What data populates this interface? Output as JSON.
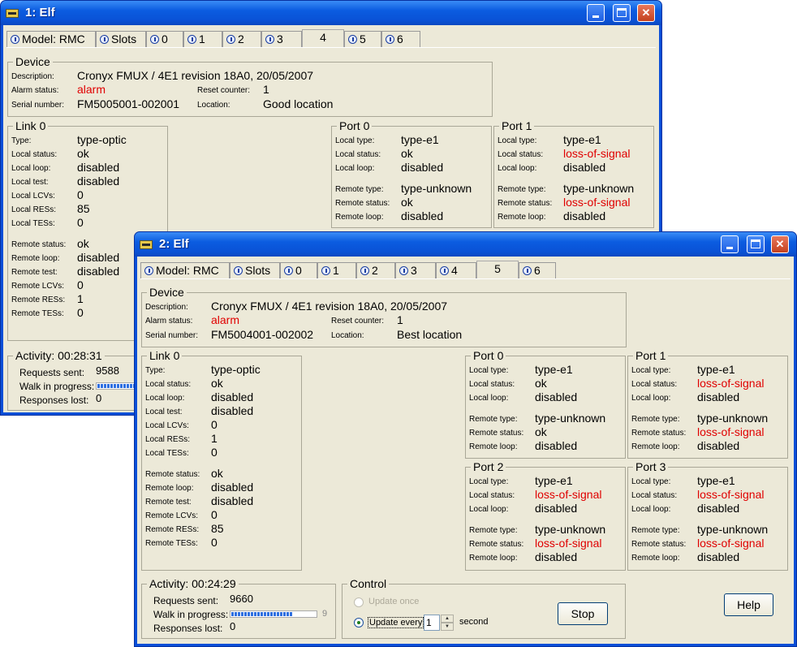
{
  "w1": {
    "title": "1: Elf",
    "tabs": [
      "Model: RMC",
      "Slots",
      "0",
      "1",
      "2",
      "3",
      "4",
      "5",
      "6"
    ],
    "device": {
      "heading": "Device",
      "description_label": "Description:",
      "description": "Cronyx FMUX / 4E1 revision 18A0, 20/05/2007",
      "alarm_label": "Alarm status:",
      "alarm": "alarm",
      "serial_label": "Serial number:",
      "serial": "FM5005001-002001",
      "reset_label": "Reset counter:",
      "reset": "1",
      "location_label": "Location:",
      "location": "Good location"
    },
    "link": {
      "heading": "Link 0",
      "rows": [
        {
          "l": "Type:",
          "v": "type-optic"
        },
        {
          "l": "Local status:",
          "v": "ok"
        },
        {
          "l": "Local loop:",
          "v": "disabled"
        },
        {
          "l": "Local test:",
          "v": "disabled"
        },
        {
          "l": "Local LCVs:",
          "v": "0"
        },
        {
          "l": "Local RESs:",
          "v": "85"
        },
        {
          "l": "Local TESs:",
          "v": "0"
        },
        {
          "l": "Remote status:",
          "v": "ok"
        },
        {
          "l": "Remote loop:",
          "v": "disabled"
        },
        {
          "l": "Remote test:",
          "v": "disabled"
        },
        {
          "l": "Remote LCVs:",
          "v": "0"
        },
        {
          "l": "Remote RESs:",
          "v": "1"
        },
        {
          "l": "Remote TESs:",
          "v": "0"
        }
      ]
    },
    "ports": [
      {
        "heading": "Port 0",
        "rows": [
          {
            "l": "Local type:",
            "v": "type-e1"
          },
          {
            "l": "Local status:",
            "v": "ok"
          },
          {
            "l": "Local loop:",
            "v": "disabled"
          },
          {
            "l": "Remote type:",
            "v": "type-unknown"
          },
          {
            "l": "Remote status:",
            "v": "ok"
          },
          {
            "l": "Remote loop:",
            "v": "disabled"
          }
        ]
      },
      {
        "heading": "Port 1",
        "rows": [
          {
            "l": "Local type:",
            "v": "type-e1"
          },
          {
            "l": "Local status:",
            "v": "loss-of-signal"
          },
          {
            "l": "Local loop:",
            "v": "disabled"
          },
          {
            "l": "Remote type:",
            "v": "type-unknown"
          },
          {
            "l": "Remote status:",
            "v": "loss-of-signal"
          },
          {
            "l": "Remote loop:",
            "v": "disabled"
          }
        ]
      }
    ],
    "activity": {
      "heading": "Activity: 00:28:31",
      "requests_label": "Requests sent:",
      "requests": "9588",
      "walk_label": "Walk in progress:",
      "lost_label": "Responses lost:",
      "lost": "0"
    }
  },
  "w2": {
    "title": "2: Elf",
    "tabs": [
      "Model: RMC",
      "Slots",
      "0",
      "1",
      "2",
      "3",
      "4",
      "5",
      "6"
    ],
    "device": {
      "heading": "Device",
      "description_label": "Description:",
      "description": "Cronyx FMUX / 4E1 revision 18A0, 20/05/2007",
      "alarm_label": "Alarm status:",
      "alarm": "alarm",
      "serial_label": "Serial number:",
      "serial": "FM5004001-002002",
      "reset_label": "Reset counter:",
      "reset": "1",
      "location_label": "Location:",
      "location": "Best location"
    },
    "link": {
      "heading": "Link 0",
      "rows": [
        {
          "l": "Type:",
          "v": "type-optic"
        },
        {
          "l": "Local status:",
          "v": "ok"
        },
        {
          "l": "Local loop:",
          "v": "disabled"
        },
        {
          "l": "Local test:",
          "v": "disabled"
        },
        {
          "l": "Local LCVs:",
          "v": "0"
        },
        {
          "l": "Local RESs:",
          "v": "1"
        },
        {
          "l": "Local TESs:",
          "v": "0"
        },
        {
          "l": "Remote status:",
          "v": "ok"
        },
        {
          "l": "Remote loop:",
          "v": "disabled"
        },
        {
          "l": "Remote test:",
          "v": "disabled"
        },
        {
          "l": "Remote LCVs:",
          "v": "0"
        },
        {
          "l": "Remote RESs:",
          "v": "85"
        },
        {
          "l": "Remote TESs:",
          "v": "0"
        }
      ]
    },
    "ports": [
      {
        "heading": "Port 0",
        "rows": [
          {
            "l": "Local type:",
            "v": "type-e1"
          },
          {
            "l": "Local status:",
            "v": "ok"
          },
          {
            "l": "Local loop:",
            "v": "disabled"
          },
          {
            "l": "Remote type:",
            "v": "type-unknown"
          },
          {
            "l": "Remote status:",
            "v": "ok"
          },
          {
            "l": "Remote loop:",
            "v": "disabled"
          }
        ]
      },
      {
        "heading": "Port 1",
        "rows": [
          {
            "l": "Local type:",
            "v": "type-e1"
          },
          {
            "l": "Local status:",
            "v": "loss-of-signal"
          },
          {
            "l": "Local loop:",
            "v": "disabled"
          },
          {
            "l": "Remote type:",
            "v": "type-unknown"
          },
          {
            "l": "Remote status:",
            "v": "loss-of-signal"
          },
          {
            "l": "Remote loop:",
            "v": "disabled"
          }
        ]
      },
      {
        "heading": "Port 2",
        "rows": [
          {
            "l": "Local type:",
            "v": "type-e1"
          },
          {
            "l": "Local status:",
            "v": "loss-of-signal"
          },
          {
            "l": "Local loop:",
            "v": "disabled"
          },
          {
            "l": "Remote type:",
            "v": "type-unknown"
          },
          {
            "l": "Remote status:",
            "v": "loss-of-signal"
          },
          {
            "l": "Remote loop:",
            "v": "disabled"
          }
        ]
      },
      {
        "heading": "Port 3",
        "rows": [
          {
            "l": "Local type:",
            "v": "type-e1"
          },
          {
            "l": "Local status:",
            "v": "loss-of-signal"
          },
          {
            "l": "Local loop:",
            "v": "disabled"
          },
          {
            "l": "Remote type:",
            "v": "type-unknown"
          },
          {
            "l": "Remote status:",
            "v": "loss-of-signal"
          },
          {
            "l": "Remote loop:",
            "v": "disabled"
          }
        ]
      }
    ],
    "activity": {
      "heading": "Activity: 00:24:29",
      "requests_label": "Requests sent:",
      "requests": "9660",
      "walk_label": "Walk in progress:",
      "walk": "9",
      "lost_label": "Responses lost:",
      "lost": "0"
    },
    "control": {
      "heading": "Control",
      "update_once": "Update once",
      "update_every": "Update every",
      "interval": "1",
      "unit": "second",
      "stop": "Stop",
      "help": "Help"
    }
  },
  "colors": {
    "alarm": "#e00000",
    "titlebar": "#0a52d6",
    "face": "#ece9d8"
  }
}
